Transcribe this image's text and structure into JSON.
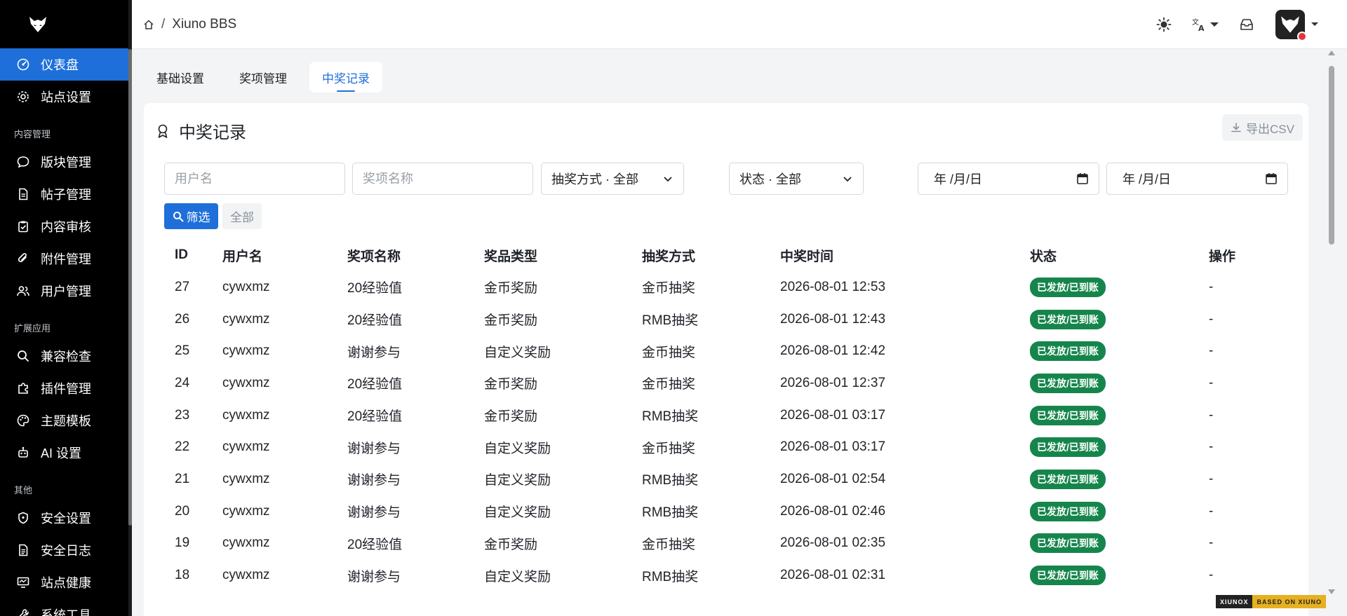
{
  "sidebar": {
    "top_items": [
      {
        "label": "仪表盘",
        "icon": "dashboard-icon",
        "active": true
      },
      {
        "label": "站点设置",
        "icon": "gear-icon"
      }
    ],
    "groups": [
      {
        "title": "内容管理",
        "items": [
          {
            "label": "版块管理",
            "icon": "chat-bubble-icon"
          },
          {
            "label": "帖子管理",
            "icon": "document-icon"
          },
          {
            "label": "内容审核",
            "icon": "clipboard-check-icon"
          },
          {
            "label": "附件管理",
            "icon": "paperclip-icon"
          },
          {
            "label": "用户管理",
            "icon": "users-icon"
          }
        ]
      },
      {
        "title": "扩展应用",
        "items": [
          {
            "label": "兼容检查",
            "icon": "search-icon"
          },
          {
            "label": "插件管理",
            "icon": "puzzle-icon"
          },
          {
            "label": "主题模板",
            "icon": "palette-icon"
          },
          {
            "label": "AI 设置",
            "icon": "robot-icon"
          }
        ]
      },
      {
        "title": "其他",
        "items": [
          {
            "label": "安全设置",
            "icon": "shield-icon"
          },
          {
            "label": "安全日志",
            "icon": "log-icon"
          },
          {
            "label": "站点健康",
            "icon": "monitor-icon"
          },
          {
            "label": "系统工具",
            "icon": "tool-icon"
          }
        ]
      }
    ]
  },
  "header": {
    "site_name": "Xiuno BBS",
    "separator": "/"
  },
  "tabs": [
    {
      "label": "基础设置",
      "active": false
    },
    {
      "label": "奖项管理",
      "active": false
    },
    {
      "label": "中奖记录",
      "active": true
    }
  ],
  "card": {
    "title": "中奖记录",
    "export_label": "导出CSV"
  },
  "filters": {
    "username_placeholder": "用户名",
    "prize_placeholder": "奖项名称",
    "method_select": "抽奖方式 · 全部",
    "status_select": "状态 · 全部",
    "date_start": "年 /月/日",
    "date_end": "年 /月/日",
    "filter_button": "筛选",
    "all_button": "全部"
  },
  "table": {
    "columns": [
      "ID",
      "用户名",
      "奖项名称",
      "奖品类型",
      "抽奖方式",
      "中奖时间",
      "状态",
      "操作"
    ],
    "rows": [
      {
        "id": "27",
        "user": "cywxmz",
        "prize": "20经验值",
        "type": "金币奖励",
        "method": "金币抽奖",
        "time": "2026-08-01 12:53",
        "status": "已发放/已到账",
        "action": "-"
      },
      {
        "id": "26",
        "user": "cywxmz",
        "prize": "20经验值",
        "type": "金币奖励",
        "method": "RMB抽奖",
        "time": "2026-08-01 12:43",
        "status": "已发放/已到账",
        "action": "-"
      },
      {
        "id": "25",
        "user": "cywxmz",
        "prize": "谢谢参与",
        "type": "自定义奖励",
        "method": "金币抽奖",
        "time": "2026-08-01 12:42",
        "status": "已发放/已到账",
        "action": "-"
      },
      {
        "id": "24",
        "user": "cywxmz",
        "prize": "20经验值",
        "type": "金币奖励",
        "method": "金币抽奖",
        "time": "2026-08-01 12:37",
        "status": "已发放/已到账",
        "action": "-"
      },
      {
        "id": "23",
        "user": "cywxmz",
        "prize": "20经验值",
        "type": "金币奖励",
        "method": "RMB抽奖",
        "time": "2026-08-01 03:17",
        "status": "已发放/已到账",
        "action": "-"
      },
      {
        "id": "22",
        "user": "cywxmz",
        "prize": "谢谢参与",
        "type": "自定义奖励",
        "method": "金币抽奖",
        "time": "2026-08-01 03:17",
        "status": "已发放/已到账",
        "action": "-"
      },
      {
        "id": "21",
        "user": "cywxmz",
        "prize": "谢谢参与",
        "type": "自定义奖励",
        "method": "RMB抽奖",
        "time": "2026-08-01 02:54",
        "status": "已发放/已到账",
        "action": "-"
      },
      {
        "id": "20",
        "user": "cywxmz",
        "prize": "谢谢参与",
        "type": "自定义奖励",
        "method": "RMB抽奖",
        "time": "2026-08-01 02:46",
        "status": "已发放/已到账",
        "action": "-"
      },
      {
        "id": "19",
        "user": "cywxmz",
        "prize": "20经验值",
        "type": "金币奖励",
        "method": "金币抽奖",
        "time": "2026-08-01 02:35",
        "status": "已发放/已到账",
        "action": "-"
      },
      {
        "id": "18",
        "user": "cywxmz",
        "prize": "谢谢参与",
        "type": "自定义奖励",
        "method": "RMB抽奖",
        "time": "2026-08-01 02:31",
        "status": "已发放/已到账",
        "action": "-"
      }
    ]
  },
  "footer_badge": {
    "left": "XIUNOX",
    "right": "BASED ON XIUNO"
  },
  "colors": {
    "primary": "#1e6fd9",
    "success": "#15854c",
    "sidebar_bg": "#000000"
  }
}
